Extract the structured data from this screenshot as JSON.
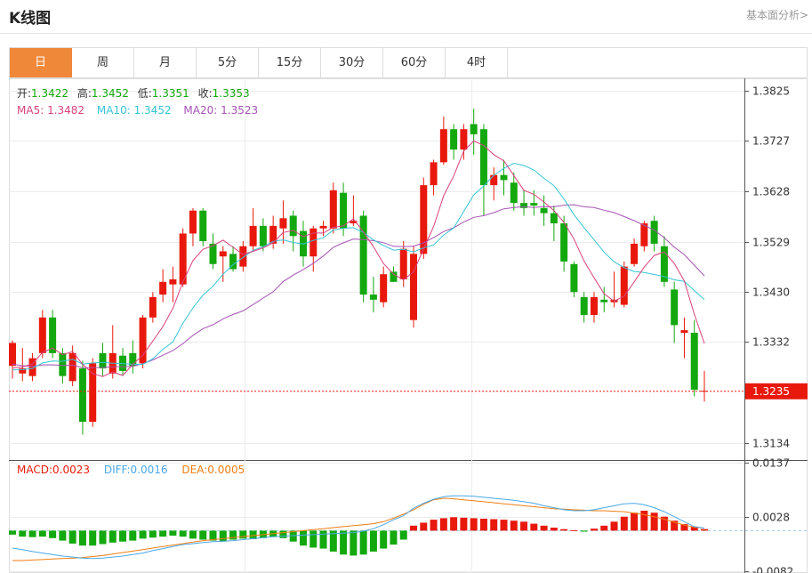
{
  "header": {
    "title": "K线图",
    "link_label": "基本面分析>"
  },
  "tabs": [
    {
      "label": "日",
      "active": true
    },
    {
      "label": "周",
      "active": false
    },
    {
      "label": "月",
      "active": false
    },
    {
      "label": "5分",
      "active": false
    },
    {
      "label": "15分",
      "active": false
    },
    {
      "label": "30分",
      "active": false
    },
    {
      "label": "60分",
      "active": false
    },
    {
      "label": "4时",
      "active": false
    }
  ],
  "ohlc_info": {
    "open_label": "开:",
    "open": "1.3422",
    "high_label": "高:",
    "high": "1.3452",
    "low_label": "低:",
    "low": "1.3351",
    "close_label": "收:",
    "close": "1.3353"
  },
  "ma_info": {
    "ma5_label": "MA5: ",
    "ma5": "1.3482",
    "ma10_label": "MA10: ",
    "ma10": "1.3452",
    "ma20_label": "MA20: ",
    "ma20": "1.3523"
  },
  "macd_info": {
    "macd_label": "MACD:",
    "macd": "0.0023",
    "diff_label": "DIFF:",
    "diff": "0.0016",
    "dea_label": "DEA:",
    "dea": "0.0005"
  },
  "colors": {
    "up": "#e8190c",
    "down": "#13a80e",
    "ma5": "#d9417d",
    "ma10": "#35c4d6",
    "ma20": "#a653b5",
    "diff": "#4aa8e8",
    "dea": "#f07e14",
    "current": "#e8190c",
    "tab_active": "#f0883a"
  },
  "chart_data": {
    "type": "candlestick",
    "price_axis": {
      "ticks": [
        "1.3825",
        "1.3727",
        "1.3628",
        "1.3529",
        "1.3430",
        "1.3332",
        "1.3134"
      ],
      "range": [
        1.31,
        1.385
      ]
    },
    "current_price": "1.3235",
    "candles": [
      [
        1.3285,
        1.3335,
        1.326,
        1.333
      ],
      [
        1.327,
        1.332,
        1.3255,
        1.328
      ],
      [
        1.3265,
        1.331,
        1.3255,
        1.33
      ],
      [
        1.331,
        1.3395,
        1.33,
        1.338
      ],
      [
        1.338,
        1.3395,
        1.33,
        1.331
      ],
      [
        1.331,
        1.332,
        1.325,
        1.3265
      ],
      [
        1.3255,
        1.3325,
        1.3245,
        1.331
      ],
      [
        1.328,
        1.3295,
        1.315,
        1.3175
      ],
      [
        1.3175,
        1.33,
        1.3165,
        1.329
      ],
      [
        1.331,
        1.333,
        1.3265,
        1.328
      ],
      [
        1.327,
        1.3365,
        1.326,
        1.331
      ],
      [
        1.3305,
        1.332,
        1.3265,
        1.3275
      ],
      [
        1.331,
        1.3335,
        1.327,
        1.3285
      ],
      [
        1.329,
        1.3385,
        1.328,
        1.338
      ],
      [
        1.338,
        1.343,
        1.337,
        1.342
      ],
      [
        1.3425,
        1.3475,
        1.341,
        1.345
      ],
      [
        1.3445,
        1.348,
        1.341,
        1.3455
      ],
      [
        1.3445,
        1.3555,
        1.344,
        1.3545
      ],
      [
        1.3545,
        1.3595,
        1.352,
        1.359
      ],
      [
        1.359,
        1.3595,
        1.352,
        1.353
      ],
      [
        1.3525,
        1.3545,
        1.3475,
        1.3485
      ],
      [
        1.35,
        1.352,
        1.345,
        1.351
      ],
      [
        1.3505,
        1.352,
        1.347,
        1.3475
      ],
      [
        1.348,
        1.353,
        1.347,
        1.352
      ],
      [
        1.352,
        1.3595,
        1.351,
        1.356
      ],
      [
        1.356,
        1.3575,
        1.351,
        1.352
      ],
      [
        1.3525,
        1.358,
        1.3515,
        1.356
      ],
      [
        1.3555,
        1.361,
        1.3525,
        1.3575
      ],
      [
        1.358,
        1.359,
        1.351,
        1.354
      ],
      [
        1.355,
        1.357,
        1.348,
        1.35
      ],
      [
        1.35,
        1.356,
        1.347,
        1.3555
      ],
      [
        1.3555,
        1.357,
        1.354,
        1.356
      ],
      [
        1.3555,
        1.3645,
        1.3545,
        1.363
      ],
      [
        1.3625,
        1.3645,
        1.354,
        1.3555
      ],
      [
        1.3565,
        1.362,
        1.356,
        1.357
      ],
      [
        1.358,
        1.359,
        1.341,
        1.3425
      ],
      [
        1.3425,
        1.346,
        1.339,
        1.3415
      ],
      [
        1.341,
        1.348,
        1.34,
        1.3465
      ],
      [
        1.347,
        1.348,
        1.345,
        1.345
      ],
      [
        1.3455,
        1.353,
        1.344,
        1.3515
      ],
      [
        1.3375,
        1.352,
        1.336,
        1.3505
      ],
      [
        1.3505,
        1.3655,
        1.3495,
        1.364
      ],
      [
        1.364,
        1.369,
        1.362,
        1.3685
      ],
      [
        1.3685,
        1.3775,
        1.368,
        1.375
      ],
      [
        1.375,
        1.376,
        1.369,
        1.371
      ],
      [
        1.371,
        1.376,
        1.369,
        1.375
      ],
      [
        1.376,
        1.379,
        1.37,
        1.374
      ],
      [
        1.375,
        1.376,
        1.358,
        1.364
      ],
      [
        1.364,
        1.3675,
        1.361,
        1.366
      ],
      [
        1.366,
        1.369,
        1.362,
        1.365
      ],
      [
        1.3645,
        1.3665,
        1.359,
        1.3605
      ],
      [
        1.3605,
        1.363,
        1.358,
        1.3595
      ],
      [
        1.3605,
        1.363,
        1.358,
        1.36
      ],
      [
        1.3595,
        1.362,
        1.356,
        1.3585
      ],
      [
        1.3585,
        1.36,
        1.353,
        1.3565
      ],
      [
        1.3565,
        1.358,
        1.347,
        1.349
      ],
      [
        1.3485,
        1.349,
        1.342,
        1.343
      ],
      [
        1.342,
        1.343,
        1.337,
        1.3385
      ],
      [
        1.3385,
        1.343,
        1.337,
        1.342
      ],
      [
        1.3415,
        1.344,
        1.339,
        1.341
      ],
      [
        1.341,
        1.347,
        1.34,
        1.3415
      ],
      [
        1.3405,
        1.349,
        1.34,
        1.348
      ],
      [
        1.3485,
        1.3535,
        1.348,
        1.3525
      ],
      [
        1.352,
        1.357,
        1.351,
        1.3565
      ],
      [
        1.357,
        1.358,
        1.351,
        1.3525
      ],
      [
        1.352,
        1.354,
        1.344,
        1.345
      ],
      [
        1.3435,
        1.345,
        1.333,
        1.3365
      ],
      [
        1.335,
        1.338,
        1.33,
        1.3355
      ],
      [
        1.335,
        1.3375,
        1.3225,
        1.3238
      ],
      [
        1.3235,
        1.3275,
        1.3215,
        1.3236
      ]
    ],
    "macd_axis": {
      "ticks": [
        "0.0137",
        "0.0028",
        "-0.0082"
      ],
      "range": [
        -0.0085,
        0.014
      ]
    },
    "macd_hist": [
      -0.0008,
      -0.0012,
      -0.0013,
      -0.0012,
      -0.0015,
      -0.002,
      -0.0026,
      -0.003,
      -0.003,
      -0.0027,
      -0.0024,
      -0.0022,
      -0.002,
      -0.0016,
      -0.0014,
      -0.0012,
      -0.001,
      -0.0012,
      -0.0016,
      -0.0018,
      -0.002,
      -0.0022,
      -0.0018,
      -0.0016,
      -0.0017,
      -0.0015,
      -0.0013,
      -0.0015,
      -0.0022,
      -0.003,
      -0.0034,
      -0.0036,
      -0.0042,
      -0.0048,
      -0.005,
      -0.0048,
      -0.0042,
      -0.0036,
      -0.0028,
      -0.0018,
      0.001,
      0.0016,
      0.0022,
      0.0025,
      0.0027,
      0.0026,
      0.0025,
      0.0024,
      0.0023,
      0.0022,
      0.002,
      0.0018,
      0.0014,
      0.001,
      0.0006,
      0.0003,
      0.0001,
      -0.0002,
      0.0004,
      0.001,
      0.0018,
      0.0028,
      0.0036,
      0.004,
      0.0036,
      0.0028,
      0.002,
      0.0013,
      0.0008,
      0.0003
    ],
    "diff": [
      -0.0035,
      -0.0038,
      -0.0042,
      -0.0045,
      -0.0048,
      -0.0051,
      -0.0053,
      -0.0055,
      -0.0056,
      -0.0055,
      -0.0053,
      -0.0051,
      -0.0048,
      -0.0045,
      -0.004,
      -0.0036,
      -0.0032,
      -0.0028,
      -0.0026,
      -0.0024,
      -0.0022,
      -0.0021,
      -0.002,
      -0.0018,
      -0.0016,
      -0.0014,
      -0.0012,
      -0.0011,
      -0.001,
      -0.0009,
      -0.0008,
      -0.0007,
      -0.0006,
      -0.0005,
      -0.0004,
      -0.0001,
      0.0004,
      0.0012,
      0.0022,
      0.003,
      0.0045,
      0.0055,
      0.0063,
      0.0068,
      0.007,
      0.007,
      0.0069,
      0.0067,
      0.0065,
      0.0063,
      0.0061,
      0.0058,
      0.0055,
      0.005,
      0.0046,
      0.0042,
      0.004,
      0.004,
      0.0042,
      0.0046,
      0.005,
      0.0054,
      0.0055,
      0.0052,
      0.0046,
      0.0038,
      0.0028,
      0.0018,
      0.0008,
      0.0005
    ],
    "dea": [
      -0.006,
      -0.006,
      -0.0059,
      -0.0058,
      -0.0057,
      -0.0056,
      -0.0055,
      -0.0054,
      -0.0052,
      -0.005,
      -0.0047,
      -0.0044,
      -0.0041,
      -0.0038,
      -0.0035,
      -0.0032,
      -0.0029,
      -0.0026,
      -0.0023,
      -0.002,
      -0.0018,
      -0.0016,
      -0.0014,
      -0.0012,
      -0.001,
      -0.0008,
      -0.0006,
      -0.0004,
      -0.0002,
      0.0,
      0.0002,
      0.0004,
      0.0006,
      0.0008,
      0.001,
      0.0012,
      0.0014,
      0.0018,
      0.0025,
      0.0033,
      0.0042,
      0.0053,
      0.0062,
      0.0065,
      0.0064,
      0.0062,
      0.006,
      0.0058,
      0.0056,
      0.0054,
      0.0052,
      0.005,
      0.0048,
      0.0046,
      0.0044,
      0.0043,
      0.0042,
      0.0041,
      0.004,
      0.004,
      0.0039,
      0.0038,
      0.0035,
      0.0032,
      0.0028,
      0.0023,
      0.0017,
      0.0011,
      0.0007,
      0.0005
    ]
  }
}
